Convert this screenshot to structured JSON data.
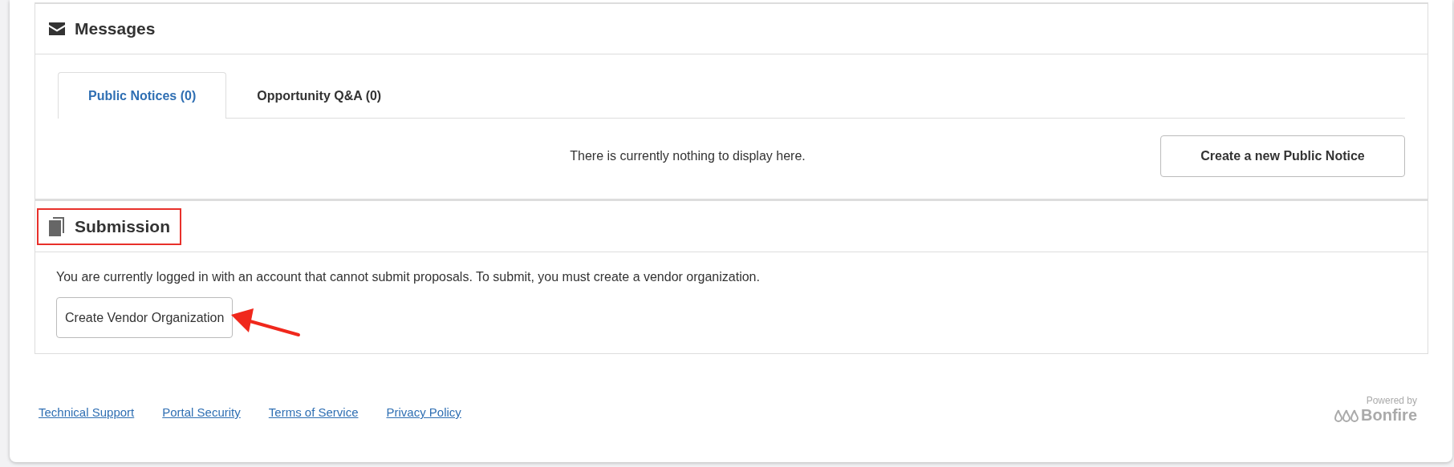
{
  "messages": {
    "title": "Messages",
    "tabs": [
      {
        "label": "Public Notices (0)",
        "selected": true
      },
      {
        "label": "Opportunity Q&A (0)",
        "selected": false
      }
    ],
    "empty_text": "There is currently nothing to display here.",
    "action_button": "Create a new Public Notice"
  },
  "submission": {
    "title": "Submission",
    "highlighted": true,
    "notice": "You are currently logged in with an account that cannot submit proposals. To submit, you must create a vendor organization.",
    "button": "Create Vendor Organization",
    "button_annotated": true
  },
  "footer": {
    "links": [
      "Technical Support",
      "Portal Security",
      "Terms of Service",
      "Privacy Policy"
    ],
    "powered_by": "Powered by",
    "brand": "Bonfire"
  }
}
